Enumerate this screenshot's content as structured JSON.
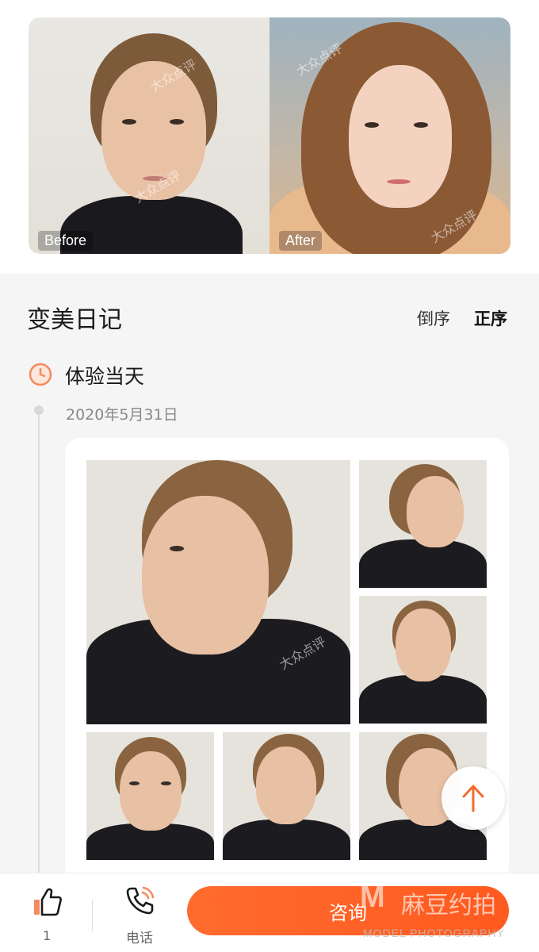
{
  "before_after": {
    "before_label": "Before",
    "after_label": "After",
    "watermark": "大众点评"
  },
  "diary": {
    "title": "变美日记",
    "sort_desc": "倒序",
    "sort_asc": "正序",
    "active_sort": "正序"
  },
  "entry": {
    "title": "体验当天",
    "date": "2020年5月31日",
    "photo_count": 7
  },
  "bottom_bar": {
    "like_count": "1",
    "phone_label": "电话",
    "consult_label": "咨询"
  },
  "corner_watermark": {
    "letter": "M",
    "text": "麻豆约拍",
    "subtext": "MODEL PHOTOGRAPHY"
  },
  "colors": {
    "accent": "#ff5f22",
    "icon_orange": "#f58a5c",
    "background": "#f5f5f5"
  },
  "icons": {
    "clock": "clock-icon",
    "like": "thumbs-up-icon",
    "phone": "phone-icon",
    "up": "arrow-up-icon"
  }
}
